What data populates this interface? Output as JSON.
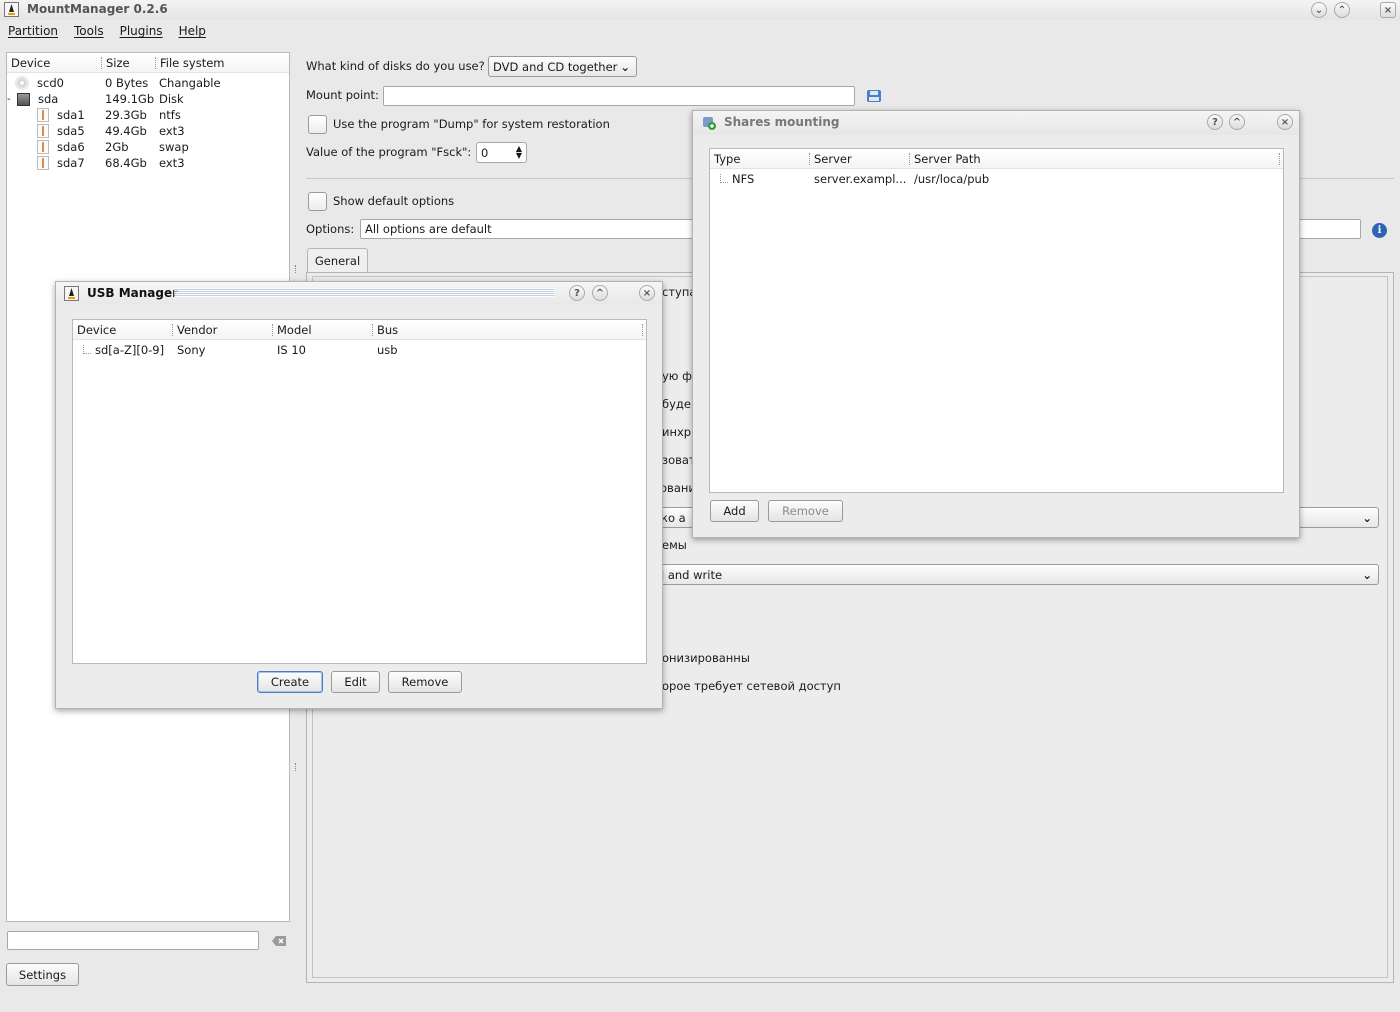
{
  "app": {
    "title": "MountManager 0.2.6"
  },
  "menu": [
    "Partition",
    "Tools",
    "Plugins",
    "Help"
  ],
  "device_tree": {
    "columns": [
      "Device",
      "Size",
      "File system"
    ],
    "rows": [
      {
        "device": "scd0",
        "size": "0 Bytes",
        "fs": "Changable",
        "level": 0,
        "icon": "cdrom-icon"
      },
      {
        "device": "sda",
        "size": "149.1Gb",
        "fs": "Disk",
        "level": 0,
        "icon": "hard-disk-icon"
      },
      {
        "device": "sda1",
        "size": "29.3Gb",
        "fs": "ntfs",
        "level": 1,
        "icon": "partition-icon"
      },
      {
        "device": "sda5",
        "size": "49.4Gb",
        "fs": "ext3",
        "level": 1,
        "icon": "partition-icon"
      },
      {
        "device": "sda6",
        "size": "2Gb",
        "fs": "swap",
        "level": 1,
        "icon": "partition-icon"
      },
      {
        "device": "sda7",
        "size": "68.4Gb",
        "fs": "ext3",
        "level": 1,
        "icon": "partition-icon"
      }
    ],
    "collapse_marker": "-"
  },
  "sidebar": {
    "filter_placeholder": "",
    "settings_label": "Settings"
  },
  "main": {
    "disk_question": "What kind of disks do you use?",
    "disk_select": "DVD and CD together",
    "mount_point_label": "Mount point:",
    "mount_point_value": "",
    "dump_label": "Use the program \"Dump\" for system restoration",
    "fsck_label": "Value of the program \"Fsck\":",
    "fsck_value": "0",
    "show_default_label": "Show default options",
    "options_label": "Options:",
    "options_value": "All options are default",
    "tab_general": "General",
    "ghost_texts": [
      "ступа",
      "ую ф",
      "буде",
      "инхр",
      "зоват",
      "овани",
      "ко а",
      "емы",
      "онизированны",
      "орое требует сетевой доступ"
    ],
    "combo_1_value": "",
    "combo_2_value": "l and write"
  },
  "usb_dialog": {
    "title": "USB Manager",
    "columns": [
      "Device",
      "Vendor",
      "Model",
      "Bus"
    ],
    "rows": [
      {
        "device": "sd[a-Z][0-9]",
        "vendor": "Sony",
        "model": "IS 10",
        "bus": "usb"
      }
    ],
    "buttons": {
      "create": "Create",
      "edit": "Edit",
      "remove": "Remove"
    },
    "title_buttons": {
      "help": "?",
      "shade": "^",
      "close": "×"
    }
  },
  "shares_dialog": {
    "title": "Shares mounting",
    "columns": [
      "Type",
      "Server",
      "Server Path"
    ],
    "rows": [
      {
        "type": "NFS",
        "server": "server.exampl...",
        "path": "/usr/loca/pub"
      }
    ],
    "buttons": {
      "add": "Add",
      "remove": "Remove"
    },
    "title_buttons": {
      "help": "?",
      "shade": "^",
      "close": "×"
    }
  },
  "window_buttons": {
    "minimize": "⌄",
    "maximize": "⌃",
    "close": "×"
  }
}
